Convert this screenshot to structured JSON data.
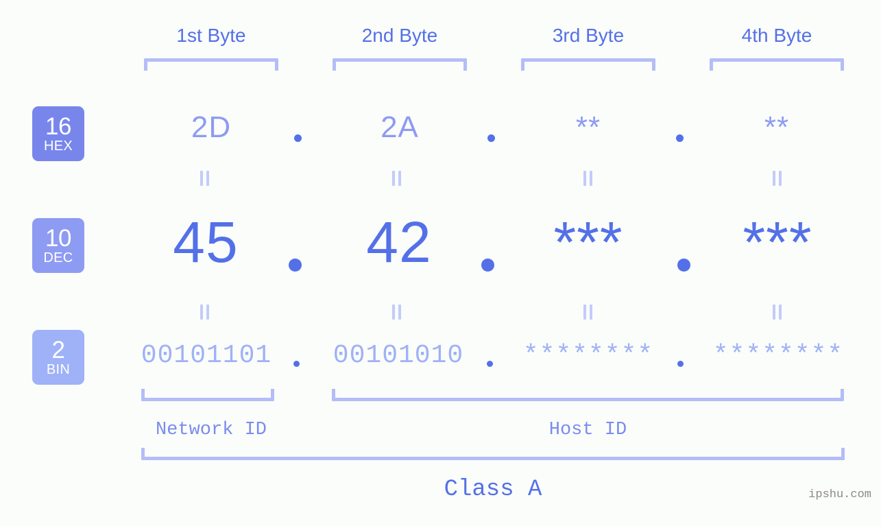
{
  "meta": {
    "watermark": "ipshu.com",
    "background_color": "#fbfdfa",
    "accent_strong": "#5470e8",
    "accent_mid": "#8e9bf2",
    "accent_light": "#9fb1f7",
    "bracket_color": "#b4bdf7"
  },
  "byte_headers": [
    {
      "label": "1st Byte"
    },
    {
      "label": "2nd Byte"
    },
    {
      "label": "3rd Byte"
    },
    {
      "label": "4th Byte"
    }
  ],
  "bases": [
    {
      "number": "16",
      "name": "HEX",
      "color": "#7886ec"
    },
    {
      "number": "10",
      "name": "DEC",
      "color": "#8e9bf2"
    },
    {
      "number": "2",
      "name": "BIN",
      "color": "#9fb1f7"
    }
  ],
  "rows": {
    "hex": {
      "base_number": "16",
      "base_name": "HEX",
      "values": [
        "2D",
        "2A",
        "**",
        "**"
      ]
    },
    "dec": {
      "base_number": "10",
      "base_name": "DEC",
      "values": [
        "45",
        "42",
        "***",
        "***"
      ]
    },
    "bin": {
      "base_number": "2",
      "base_name": "BIN",
      "values": [
        "00101101",
        "00101010",
        "********",
        "********"
      ]
    }
  },
  "separator": {
    "dot": ".",
    "equality": "||"
  },
  "segments": {
    "network_id": "Network ID",
    "host_id": "Host ID",
    "class": "Class A"
  }
}
